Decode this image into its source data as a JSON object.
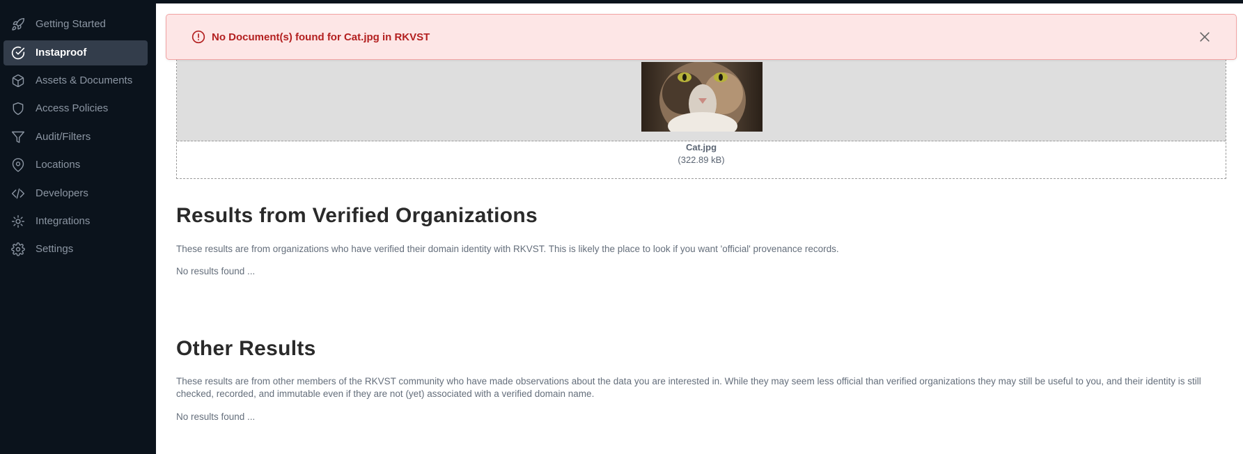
{
  "sidebar": {
    "items": [
      {
        "label": "Getting Started",
        "icon": "rocket-icon",
        "active": false
      },
      {
        "label": "Instaproof",
        "icon": "check-circle-icon",
        "active": true
      },
      {
        "label": "Assets & Documents",
        "icon": "box-icon",
        "active": false
      },
      {
        "label": "Access Policies",
        "icon": "shield-icon",
        "active": false
      },
      {
        "label": "Audit/Filters",
        "icon": "filter-icon",
        "active": false
      },
      {
        "label": "Locations",
        "icon": "map-pin-icon",
        "active": false
      },
      {
        "label": "Developers",
        "icon": "code-icon",
        "active": false
      },
      {
        "label": "Integrations",
        "icon": "integration-gear-icon",
        "active": false
      },
      {
        "label": "Settings",
        "icon": "gear-icon",
        "active": false
      }
    ]
  },
  "alert": {
    "message": "No Document(s) found for Cat.jpg in RKVST",
    "icon": "alert-circle-icon",
    "close_icon": "close-icon"
  },
  "upload": {
    "file_name": "Cat.jpg",
    "file_size": "(322.89 kB)"
  },
  "verified": {
    "title": "Results from Verified Organizations",
    "description": "These results are from organizations who have verified their domain identity with RKVST. This is likely the place to look if you want 'official' provenance records.",
    "empty_text": "No results found ..."
  },
  "other": {
    "title": "Other Results",
    "description": "These results are from other members of the RKVST community who have made observations about the data you are interested in. While they may seem less official than verified organizations they may still be useful to you, and their identity is still checked, recorded, and immutable even if they are not (yet) associated with a verified domain name.",
    "empty_text": "No results found ..."
  },
  "colors": {
    "sidebar_bg": "#0b131c",
    "active_item_bg": "#333d4b",
    "alert_bg": "#fde6e6",
    "alert_text": "#b32020"
  }
}
